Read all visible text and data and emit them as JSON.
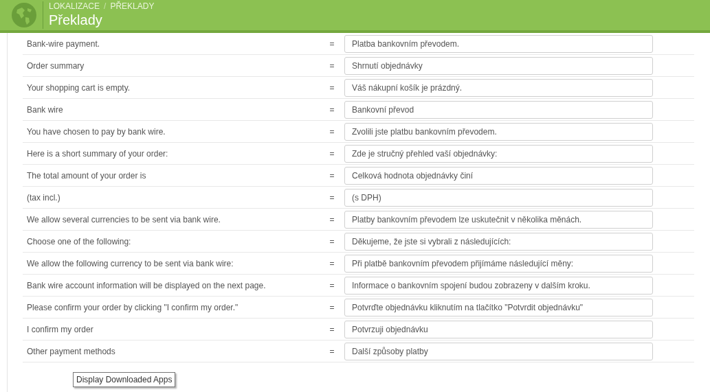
{
  "header": {
    "breadcrumb": [
      "LOKALIZACE",
      "PŘEKLADY"
    ],
    "separator": "/",
    "title": "Překlady"
  },
  "rows": [
    {
      "source": "Bank-wire payment.",
      "equals": "=",
      "translation": "Platba bankovním převodem."
    },
    {
      "source": "Order summary",
      "equals": "=",
      "translation": "Shrnutí objednávky"
    },
    {
      "source": "Your shopping cart is empty.",
      "equals": "=",
      "translation": "Váš nákupní košík je prázdný."
    },
    {
      "source": "Bank wire",
      "equals": "=",
      "translation": "Bankovní převod"
    },
    {
      "source": "You have chosen to pay by bank wire.",
      "equals": "=",
      "translation": "Zvolili jste platbu bankovním převodem."
    },
    {
      "source": "Here is a short summary of your order:",
      "equals": "=",
      "translation": "Zde je stručný přehled vaší objednávky:"
    },
    {
      "source": "The total amount of your order is",
      "equals": "=",
      "translation": "Celková hodnota objednávky činí"
    },
    {
      "source": "(tax incl.)",
      "equals": "=",
      "translation": "(s DPH)"
    },
    {
      "source": "We allow several currencies to be sent via bank wire.",
      "equals": "=",
      "translation": "Platby bankovním převodem lze uskutečnit v několika měnách."
    },
    {
      "source": "Choose one of the following:",
      "equals": "=",
      "translation": "Děkujeme, že jste si vybrali z následujících:"
    },
    {
      "source": "We allow the following currency to be sent via bank wire:",
      "equals": "=",
      "translation": "Při platbě bankovním převodem přijímáme následující měny:"
    },
    {
      "source": "Bank wire account information will be displayed on the next page.",
      "equals": "=",
      "translation": "Informace o bankovním spojení budou zobrazeny v dalším kroku."
    },
    {
      "source": "Please confirm your order by clicking \"I confirm my order.\"",
      "equals": "=",
      "translation": "Potvrďte objednávku kliknutím na tlačítko \"Potvrdit objednávku\""
    },
    {
      "source": "I confirm my order",
      "equals": "=",
      "translation": "Potvrzuji objednávku"
    },
    {
      "source": "Other payment methods",
      "equals": "=",
      "translation": "Další způsoby platby"
    }
  ],
  "tooltip": "Display Downloaded Apps"
}
